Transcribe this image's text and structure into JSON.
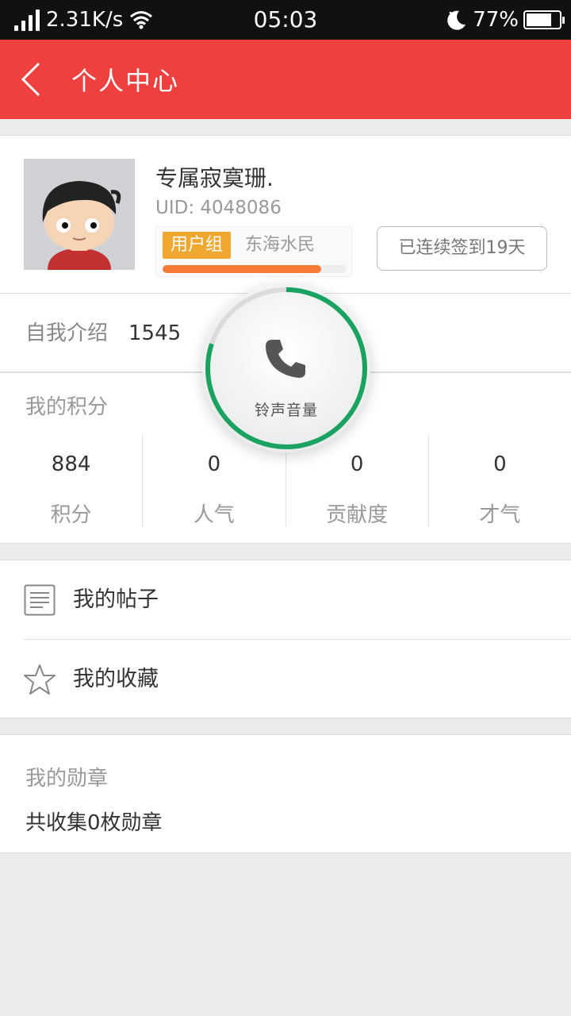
{
  "status_bar": {
    "speed": "2.31K/s",
    "time": "05:03",
    "battery": "77%",
    "battery_level": 0.77
  },
  "header": {
    "title": "个人中心"
  },
  "profile": {
    "username": "专属寂寞珊.",
    "uid": "UID: 4048086",
    "group_label": "用户组",
    "group_name": "东海水民",
    "group_progress": 0.86,
    "checkin_label": "已连续签到19天"
  },
  "intro": {
    "label": "自我介绍",
    "value": "1545"
  },
  "points": {
    "title": "我的积分",
    "stats": [
      {
        "value": "884",
        "label": "积分"
      },
      {
        "value": "0",
        "label": "人气"
      },
      {
        "value": "0",
        "label": "贡献度"
      },
      {
        "value": "0",
        "label": "才气"
      }
    ]
  },
  "menu": {
    "posts": "我的帖子",
    "favorites": "我的收藏"
  },
  "medals": {
    "title": "我的勋章",
    "summary": "共收集0枚勋章"
  },
  "volume_overlay": {
    "label": "铃声音量",
    "level": 0.8
  },
  "colors": {
    "header": "#ef4040",
    "group_badge": "#f0a830",
    "progress": "#f47a35",
    "volume_ring": "#1aa260"
  }
}
